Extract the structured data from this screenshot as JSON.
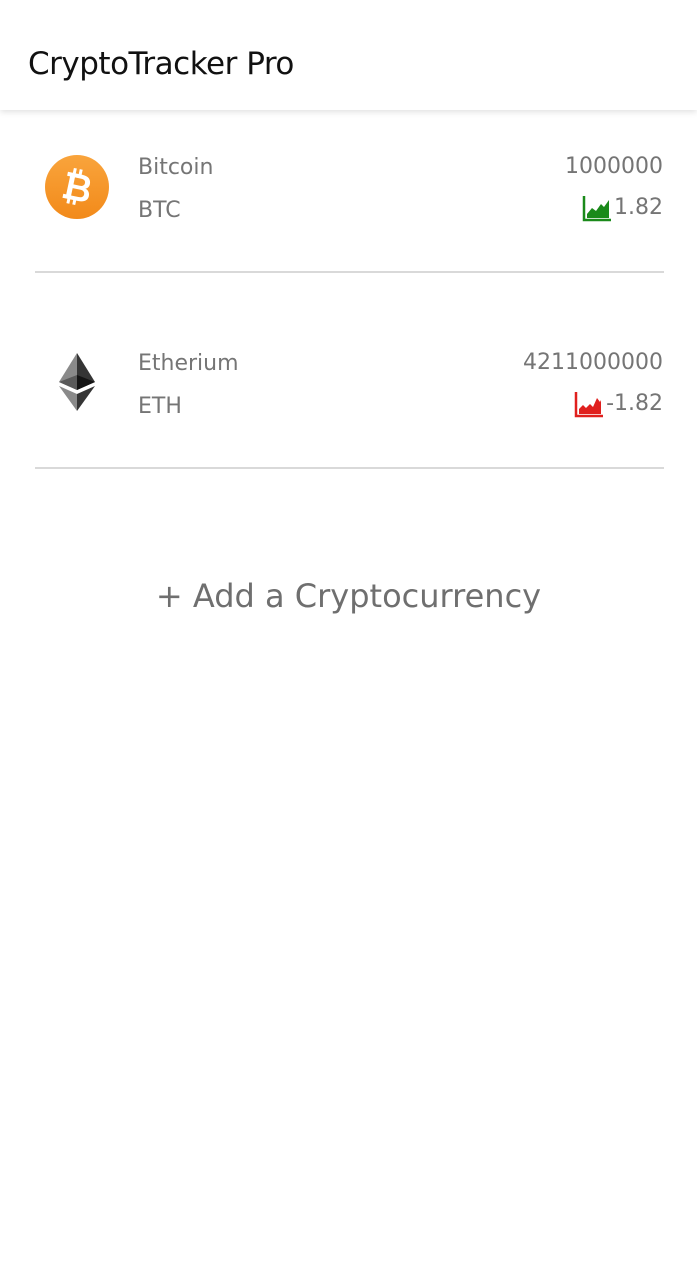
{
  "app_bar": {
    "title": "CryptoTracker Pro"
  },
  "coins": [
    {
      "name": "Bitcoin",
      "symbol": "BTC",
      "price": "1000000",
      "change": "1.82",
      "trend": "up",
      "logo_icon": "bitcoin-logo-icon",
      "trend_icon": "area-chart-up-icon",
      "trend_color": "#1a8a1a"
    },
    {
      "name": "Etherium",
      "symbol": "ETH",
      "price": "4211000000",
      "change": "-1.82",
      "trend": "down",
      "logo_icon": "ethereum-logo-icon",
      "trend_icon": "area-chart-down-icon",
      "trend_color": "#e0201e"
    }
  ],
  "add_button": {
    "label": "+ Add a Cryptocurrency"
  },
  "colors": {
    "bitcoin_orange": "#f7931a",
    "text_secondary": "#757575",
    "divider": "#d9d9d9"
  }
}
